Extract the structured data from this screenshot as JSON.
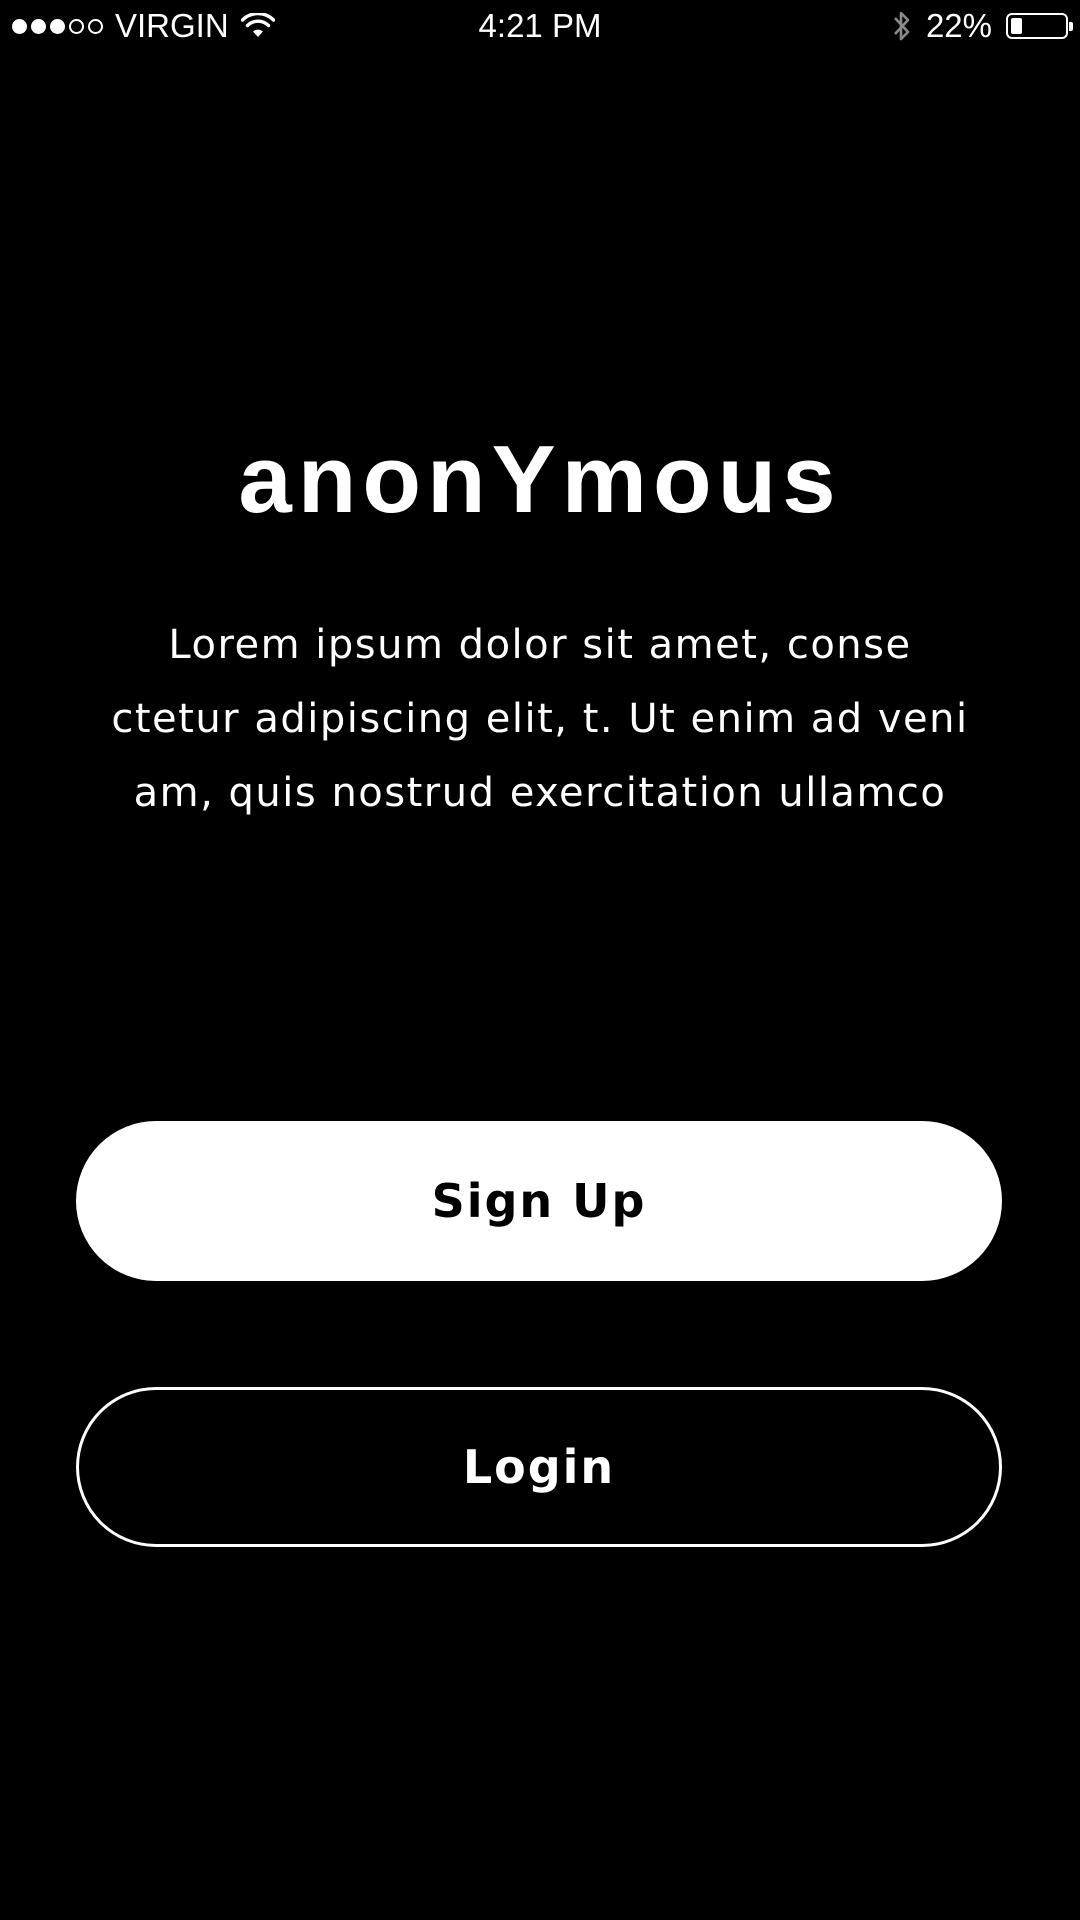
{
  "status_bar": {
    "signal_bars_filled": 3,
    "signal_bars_total": 5,
    "carrier": "VIRGIN",
    "time": "4:21 PM",
    "battery_percent": "22%",
    "battery_level": 0.22,
    "wifi_icon": "wifi-icon",
    "bluetooth_icon": "bluetooth-icon"
  },
  "app": {
    "title": "anonYmous",
    "tagline_lines": [
      "Lorem ipsum dolor sit amet, conse",
      "ctetur adipiscing elit, t. Ut enim ad veni",
      "am, quis nostrud exercitation ullamco"
    ]
  },
  "buttons": {
    "signup_label": "Sign Up",
    "login_label": "Login"
  },
  "colors": {
    "background": "#000000",
    "foreground": "#ffffff"
  }
}
